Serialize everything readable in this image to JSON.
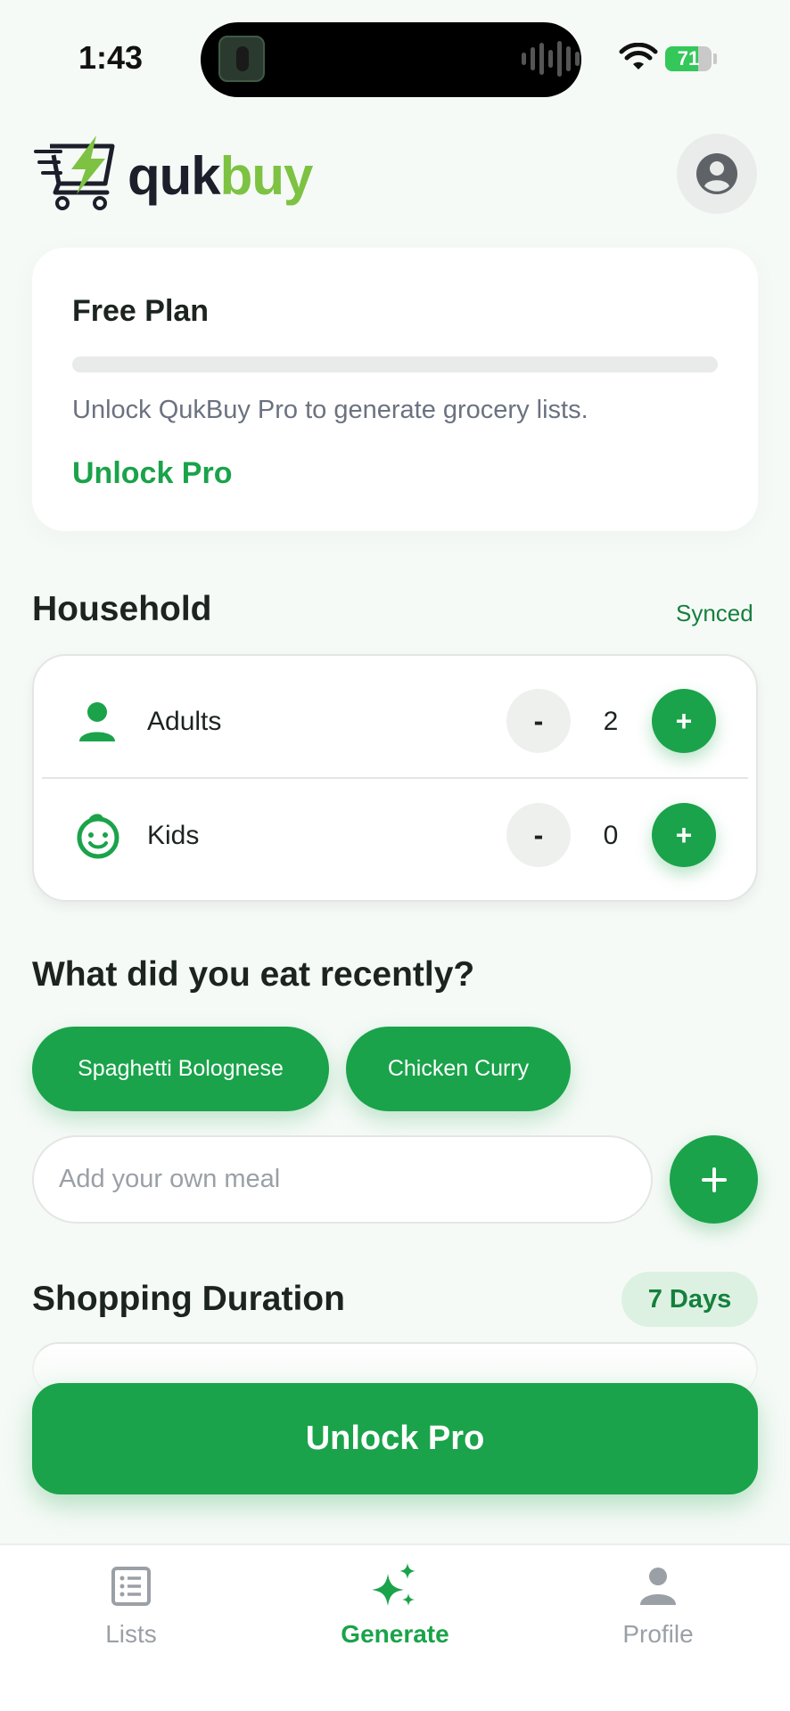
{
  "status_bar": {
    "time": "1:43",
    "battery": "71",
    "battery_level_percent": 71
  },
  "header": {
    "logo_part1": "quk",
    "logo_part2": "buy"
  },
  "plan": {
    "title": "Free Plan",
    "progress_fraction": 0,
    "description": "Unlock QukBuy Pro to generate grocery lists.",
    "link_label": "Unlock Pro"
  },
  "household": {
    "title": "Household",
    "sync_status": "Synced",
    "rows": [
      {
        "label": "Adults",
        "count": "2",
        "minus": "-",
        "plus": "+"
      },
      {
        "label": "Kids",
        "count": "0",
        "minus": "-",
        "plus": "+"
      }
    ]
  },
  "recent_meals": {
    "title": "What did you eat recently?",
    "chips": [
      "Spaghetti Bolognese",
      "Chicken Curry"
    ],
    "input_placeholder": "Add your own meal",
    "input_value": ""
  },
  "duration": {
    "title": "Shopping Duration",
    "value": "7 Days"
  },
  "cta": {
    "label": "Unlock Pro"
  },
  "tabs": [
    {
      "label": "Lists",
      "icon": "list-icon",
      "active": false
    },
    {
      "label": "Generate",
      "icon": "sparkles-icon",
      "active": true
    },
    {
      "label": "Profile",
      "icon": "person-icon",
      "active": false
    }
  ],
  "colors": {
    "accent": "#1aa34a",
    "accent_light": "#ddf1e2",
    "logo_green": "#7dc242",
    "logo_dark": "#1c1f2a",
    "background": "#f6faf7"
  }
}
